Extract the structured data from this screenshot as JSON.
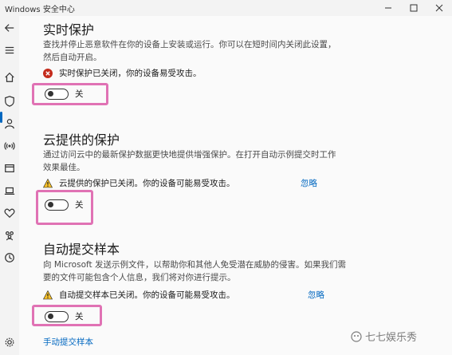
{
  "window": {
    "title": "Windows 安全中心",
    "minimize_icon": "minimize-icon",
    "maximize_icon": "maximize-icon",
    "close_icon": "close-icon"
  },
  "nav": {
    "items": [
      "back-arrow-icon",
      "hamburger-menu-icon",
      "home-icon",
      "shield-icon",
      "person-icon",
      "wifi-signal-icon",
      "app-window-icon",
      "laptop-icon",
      "heart-icon",
      "family-icon",
      "history-icon",
      "gear-icon"
    ],
    "active_item": "shield-icon",
    "accent": "#0067c0"
  },
  "sections": {
    "realtime": {
      "title": "实时保护",
      "description": "查找并停止恶意软件在你的设备上安装或运行。你可以在短时间内关闭此设置，然后自动开启。",
      "status": "实时保护已关闭，你的设备易受攻击。",
      "status_icon": "error-x-icon",
      "status_color": "#c42b1c",
      "toggle_label": "关"
    },
    "cloud": {
      "title": "云提供的保护",
      "description": "通过访问云中的最新保护数据更快地提供增强保护。在打开自动示例提交时工作效果最佳。",
      "status": "云提供的保护已关闭。你的设备可能易受攻击。",
      "status_icon": "warning-triangle-icon",
      "status_color": "#f7c12a",
      "dismiss": "忽略",
      "toggle_label": "关"
    },
    "sample": {
      "title": "自动提交样本",
      "description": "向 Microsoft 发送示例文件，以帮助你和其他人免受潜在威胁的侵害。如果我们需要的文件可能包含个人信息，我们将对你进行提示。",
      "status": "自动提交样本已关闭。你的设备可能易受攻击。",
      "status_icon": "warning-triangle-icon",
      "status_color": "#f7c12a",
      "dismiss": "忽略",
      "toggle_label": "关",
      "link": "手动提交样本"
    }
  },
  "highlight_color": "#e072b4",
  "watermark": "七七娱乐秀"
}
